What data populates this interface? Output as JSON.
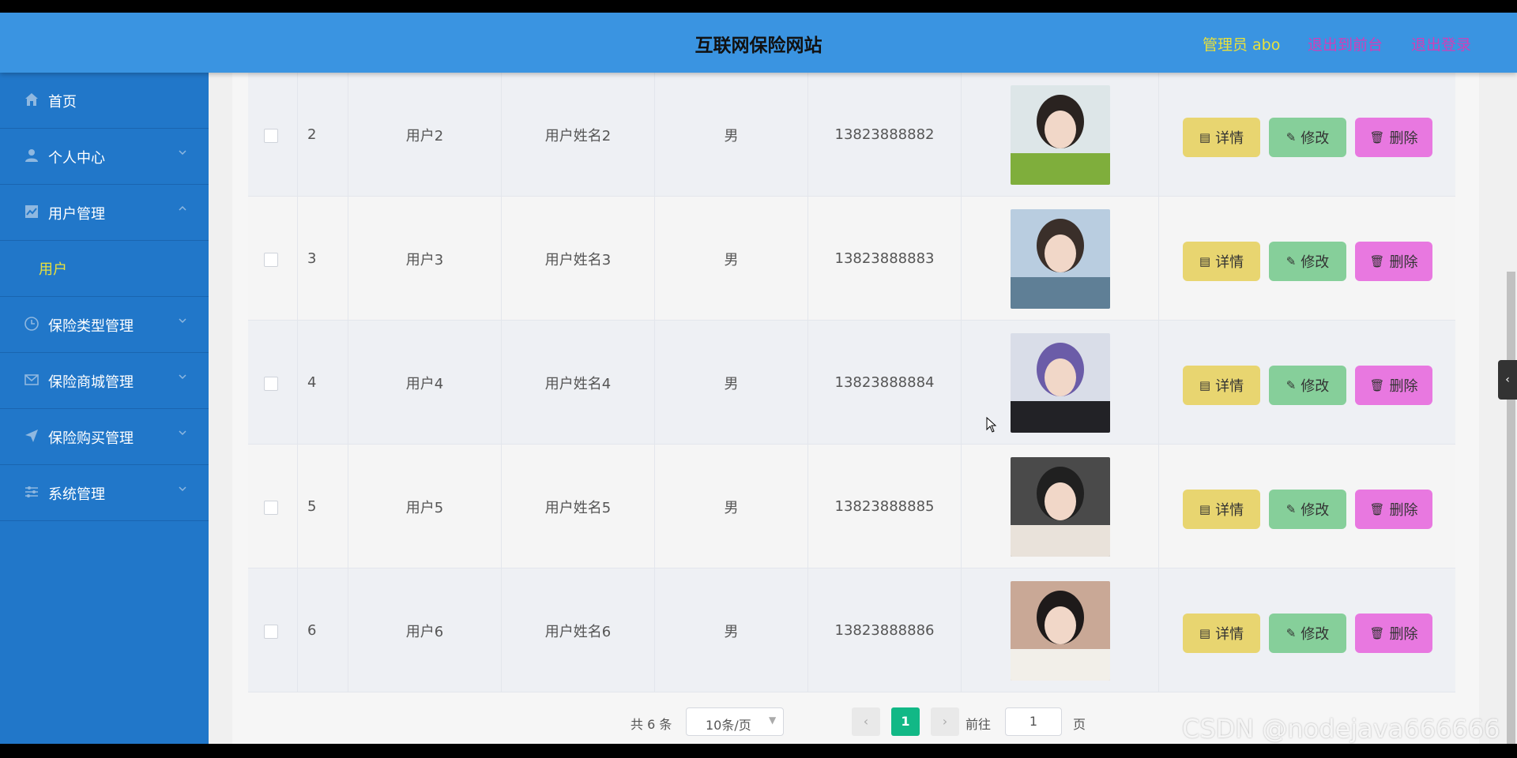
{
  "header": {
    "title": "互联网保险网站",
    "admin": "管理员 abo",
    "to_front": "退出到前台",
    "logout": "退出登录"
  },
  "sidebar": {
    "items": [
      {
        "label": "首页",
        "icon": "home-icon",
        "expandable": false
      },
      {
        "label": "个人中心",
        "icon": "user-icon",
        "expandable": true
      },
      {
        "label": "用户管理",
        "icon": "chart-icon",
        "expandable": true,
        "expanded": true,
        "children": [
          "用户"
        ]
      },
      {
        "label": "保险类型管理",
        "icon": "clock-icon",
        "expandable": true
      },
      {
        "label": "保险商城管理",
        "icon": "mail-icon",
        "expandable": true
      },
      {
        "label": "保险购买管理",
        "icon": "send-icon",
        "expandable": true
      },
      {
        "label": "系统管理",
        "icon": "sliders-icon",
        "expandable": true
      }
    ]
  },
  "table": {
    "rows": [
      {
        "index": "2",
        "account": "用户2",
        "name": "用户姓名2",
        "gender": "男",
        "phone": "13823888882",
        "photo_colors": [
          "#dde6e8",
          "#7fae3c",
          "#2a2320"
        ]
      },
      {
        "index": "3",
        "account": "用户3",
        "name": "用户姓名3",
        "gender": "男",
        "phone": "13823888883",
        "photo_colors": [
          "#b9cde0",
          "#5f7f96",
          "#3a2f2a"
        ]
      },
      {
        "index": "4",
        "account": "用户4",
        "name": "用户姓名4",
        "gender": "男",
        "phone": "13823888884",
        "photo_colors": [
          "#d9dde8",
          "#222226",
          "#6b5ca8"
        ]
      },
      {
        "index": "5",
        "account": "用户5",
        "name": "用户姓名5",
        "gender": "男",
        "phone": "13823888885",
        "photo_colors": [
          "#4a4a4a",
          "#e9e2da",
          "#202020"
        ]
      },
      {
        "index": "6",
        "account": "用户6",
        "name": "用户姓名6",
        "gender": "男",
        "phone": "13823888886",
        "photo_colors": [
          "#c9a896",
          "#f2efe9",
          "#1e1a1a"
        ]
      }
    ],
    "buttons": {
      "detail": "详情",
      "edit": "修改",
      "delete": "删除"
    }
  },
  "pagination": {
    "total": "共 6 条",
    "page_size": "10条/页",
    "current_page": "1",
    "goto_label": "前往",
    "goto_value": "1",
    "page_suffix": "页"
  },
  "watermark": "CSDN @nodejava666666",
  "colors": {
    "header_bg": "#3a94e1",
    "sidebar_bg": "#2177c9",
    "accent_yellow": "#e9e13b",
    "link_magenta": "#d03fb8",
    "btn_detail": "#e8d570",
    "btn_edit": "#86cf9a",
    "btn_delete": "#e878e0",
    "pager_active": "#12b886"
  }
}
